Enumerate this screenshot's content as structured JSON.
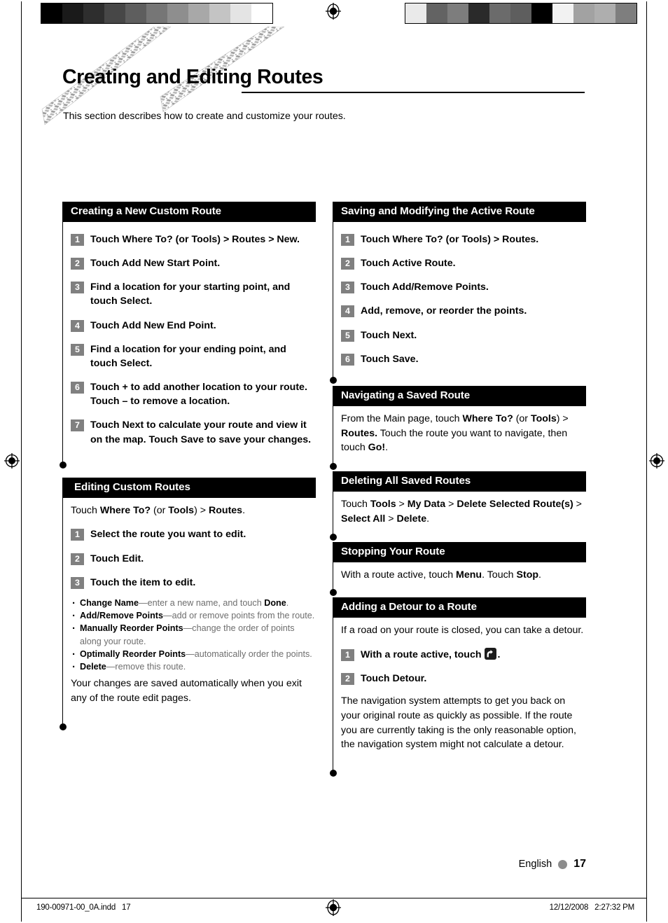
{
  "page": {
    "title": "Creating and Editing Routes",
    "intro": "This section describes how to create and customize your routes.",
    "language_label": "English",
    "page_number": "17"
  },
  "footer": {
    "file": "190-00971-00_0A.indd   17",
    "date": "12/12/2008   2:27:32 PM"
  },
  "colorbars": {
    "left": [
      "#000000",
      "#1a1a1a",
      "#2e2e2e",
      "#474747",
      "#5e5e5e",
      "#767676",
      "#8e8e8e",
      "#a8a8a8",
      "#c4c4c4",
      "#e4e4e4",
      "#ffffff"
    ],
    "right": [
      "#eaeaea",
      "#636363",
      "#7d7d7d",
      "#2a2a2a",
      "#6b6b6b",
      "#5e5e5e",
      "#000000",
      "#f2f2f2",
      "#a2a2a2",
      "#aeaeae",
      "#7e7e7e"
    ]
  },
  "left_column": {
    "creating_new_custom_route": {
      "heading": "Creating a New Custom Route",
      "steps": [
        {
          "num": "1",
          "text_html": "Touch <b>Where To? (or Tools) &gt; Routes &gt; New.</b>"
        },
        {
          "num": "2",
          "text_html": "Touch Add New Start Point."
        },
        {
          "num": "3",
          "text_html": "Find a location for your starting point, and touch Select."
        },
        {
          "num": "4",
          "text_html": "Touch Add New End Point."
        },
        {
          "num": "5",
          "text_html": "Find a location for your ending point, and touch Select."
        },
        {
          "num": "6",
          "text_html": "Touch + to add another location to your route. Touch – to remove a location."
        },
        {
          "num": "7",
          "text_html": "Touch Next to calculate your route and view it on the map. Touch Save to save your changes."
        }
      ]
    },
    "editing_custom_routes": {
      "heading": "Editing Custom Routes",
      "intro_html": "Touch <b>Where To?</b> (or <b>Tools</b>) &gt; <b>Routes</b>.",
      "steps": [
        {
          "num": "1",
          "text_html": "Select the route you want to edit."
        },
        {
          "num": "2",
          "text_html": "Touch Edit."
        },
        {
          "num": "3",
          "text_html": "Touch the item to edit."
        }
      ],
      "bullets": [
        {
          "term": "Change Name",
          "desc_html": "—enter a new name, and touch <b>Done</b>."
        },
        {
          "term": "Add/Remove Points",
          "desc_html": "—add or remove points from the route."
        },
        {
          "term": "Manually Reorder Points",
          "desc_html": "—change the order of points along your route."
        },
        {
          "term": "Optimally Reorder Points",
          "desc_html": "—automatically order the points."
        },
        {
          "term": "Delete",
          "desc_html": "—remove this route."
        }
      ],
      "closing": "Your changes are saved automatically when you exit any of the route edit pages."
    }
  },
  "right_column": {
    "saving_modifying_active_route": {
      "heading": "Saving and Modifying the Active Route",
      "steps": [
        {
          "num": "1",
          "text_html": "Touch Where To? (or Tools) &gt; Routes."
        },
        {
          "num": "2",
          "text_html": "Touch Active Route."
        },
        {
          "num": "3",
          "text_html": "Touch Add/Remove Points."
        },
        {
          "num": "4",
          "text_html": "Add, remove, or reorder the points."
        },
        {
          "num": "5",
          "text_html": "Touch Next."
        },
        {
          "num": "6",
          "text_html": "Touch Save."
        }
      ]
    },
    "navigating_saved_route": {
      "heading": "Navigating a Saved Route",
      "body_html": "From the Main page, touch <b>Where To?</b> (or <b>Tools</b>) &gt; <b>Routes.</b>  Touch the route you want to navigate, then touch <b>Go!</b>."
    },
    "deleting_all_saved_routes": {
      "heading": "Deleting All Saved Routes",
      "body_html": "Touch <b>Tools</b> &gt; <b>My Data</b> &gt; <b>Delete Selected Route(s)</b> &gt; <b>Select All</b> &gt; <b>Delete</b>."
    },
    "stopping_your_route": {
      "heading": "Stopping Your Route",
      "body_html": "With a route active, touch <b>Menu</b>. Touch <b>Stop</b>."
    },
    "adding_detour": {
      "heading": "Adding a Detour to a Route",
      "intro": "If a road on your route is closed, you can take a detour.",
      "step1_prefix": "With a route active, touch",
      "step1_suffix": ".",
      "step1_num": "1",
      "step2_num": "2",
      "step2_text": "Touch Detour.",
      "closing": "The navigation system attempts to get you back on your original route as quickly as possible. If the route you are currently taking is the only reasonable option, the navigation system might not calculate a detour."
    }
  }
}
